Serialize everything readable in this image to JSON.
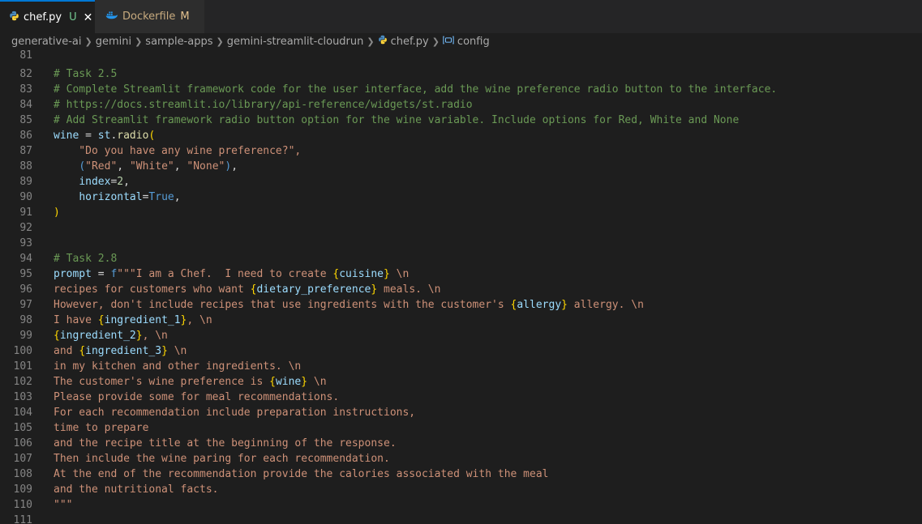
{
  "tabs": [
    {
      "label": "chef.py",
      "status": "U",
      "active": true,
      "icon": "python-icon"
    },
    {
      "label": "Dockerfile",
      "status": "M",
      "active": false,
      "icon": "docker-icon"
    }
  ],
  "breadcrumb": {
    "items": [
      "generative-ai",
      "gemini",
      "sample-apps",
      "gemini-streamlit-cloudrun",
      "chef.py",
      "config"
    ]
  },
  "editor": {
    "lines": [
      {
        "n": "81",
        "t": ""
      },
      {
        "n": "82",
        "t": "# Task 2.5"
      },
      {
        "n": "83",
        "t": "# Complete Streamlit framework code for the user interface, add the wine preference radio button to the interface."
      },
      {
        "n": "84",
        "t": "# https://docs.streamlit.io/library/api-reference/widgets/st.radio"
      },
      {
        "n": "85",
        "t": "# Add Streamlit framework radio button option for the wine variable. Include options for Red, White and None"
      },
      {
        "n": "86",
        "t": "wine = st.radio("
      },
      {
        "n": "87",
        "t": "    \"Do you have any wine preference?\","
      },
      {
        "n": "88",
        "t": "    (\"Red\", \"White\", \"None\"),"
      },
      {
        "n": "89",
        "t": "    index=2,"
      },
      {
        "n": "90",
        "t": "    horizontal=True,"
      },
      {
        "n": "91",
        "t": ")"
      },
      {
        "n": "92",
        "t": ""
      },
      {
        "n": "93",
        "t": ""
      },
      {
        "n": "94",
        "t": "# Task 2.8"
      },
      {
        "n": "95",
        "t": "prompt = f\"\"\"I am a Chef.  I need to create {cuisine} \\n"
      },
      {
        "n": "96",
        "t": "recipes for customers who want {dietary_preference} meals. \\n"
      },
      {
        "n": "97",
        "t": "However, don't include recipes that use ingredients with the customer's {allergy} allergy. \\n"
      },
      {
        "n": "98",
        "t": "I have {ingredient_1}, \\n"
      },
      {
        "n": "99",
        "t": "{ingredient_2}, \\n"
      },
      {
        "n": "100",
        "t": "and {ingredient_3} \\n"
      },
      {
        "n": "101",
        "t": "in my kitchen and other ingredients. \\n"
      },
      {
        "n": "102",
        "t": "The customer's wine preference is {wine} \\n"
      },
      {
        "n": "103",
        "t": "Please provide some for meal recommendations."
      },
      {
        "n": "104",
        "t": "For each recommendation include preparation instructions,"
      },
      {
        "n": "105",
        "t": "time to prepare"
      },
      {
        "n": "106",
        "t": "and the recipe title at the beginning of the response."
      },
      {
        "n": "107",
        "t": "Then include the wine paring for each recommendation."
      },
      {
        "n": "108",
        "t": "At the end of the recommendation provide the calories associated with the meal"
      },
      {
        "n": "109",
        "t": "and the nutritional facts."
      },
      {
        "n": "110",
        "t": "\"\"\""
      },
      {
        "n": "111",
        "t": ""
      }
    ]
  },
  "colors": {
    "background": "#1e1e1e",
    "tabbar": "#252526",
    "accent": "#0078d4",
    "comment": "#6a9955",
    "string": "#ce9178",
    "variable": "#9cdcfe",
    "keyword": "#569cd6",
    "number": "#b5cea8",
    "bracket": "#ffd700",
    "untracked": "#73c991",
    "modified": "#e2c08d"
  }
}
